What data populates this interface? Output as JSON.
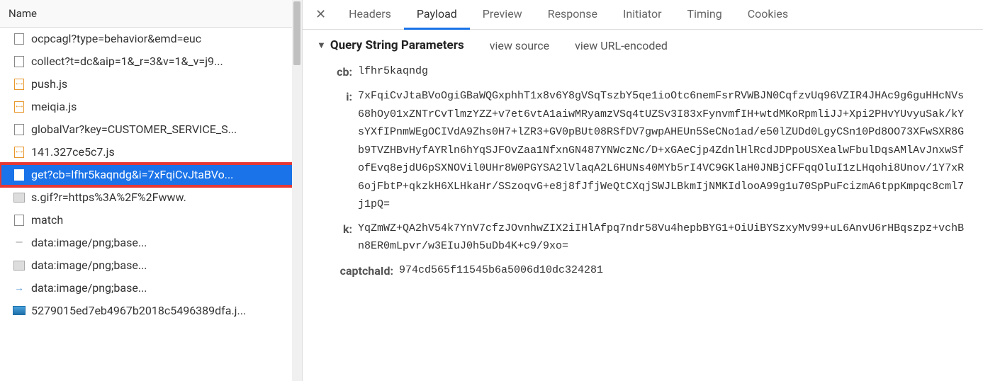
{
  "left_panel": {
    "header": "Name",
    "requests": [
      {
        "icon": "doc",
        "label": "ocpcagl?type=behavior&emd=euc"
      },
      {
        "icon": "doc",
        "label": "collect?t=dc&aip=1&_r=3&v=1&_v=j9..."
      },
      {
        "icon": "js",
        "label": "push.js"
      },
      {
        "icon": "js",
        "label": "meiqia.js"
      },
      {
        "icon": "doc",
        "label": "globalVar?key=CUSTOMER_SERVICE_S..."
      },
      {
        "icon": "js",
        "label": "141.327ce5c7.js"
      },
      {
        "icon": "fetch",
        "label": "get?cb=lfhr5kaqndg&i=7xFqiCvJtaBVo...",
        "selected": true,
        "highlighted": true
      },
      {
        "icon": "img",
        "label": "s.gif?r=https%3A%2F%2Fwww."
      },
      {
        "icon": "doc",
        "label": "match"
      },
      {
        "icon": "dash",
        "label": "data:image/png;base..."
      },
      {
        "icon": "img",
        "label": "data:image/png;base..."
      },
      {
        "icon": "arrow",
        "label": "data:image/png;base..."
      },
      {
        "icon": "pic",
        "label": "5279015ed7eb4967b2018c5496389dfa.j..."
      }
    ]
  },
  "right_panel": {
    "tabs": [
      "Headers",
      "Payload",
      "Preview",
      "Response",
      "Initiator",
      "Timing",
      "Cookies"
    ],
    "active_tab": "Payload",
    "section_title": "Query String Parameters",
    "view_source_label": "view source",
    "view_url_encoded_label": "view URL-encoded",
    "params": {
      "cb": "lfhr5kaqndg",
      "i": "7xFqiCvJtaBVoOgiGBaWQGxphhT1x8v6Y8gVSqTszbY5qe1ioOtc6nemFsrRVWBJN0CqfzvUq96VZIR4JHAc9g6guHHcNVs68hOy01xZNTrCvTlmzYZZ+v7et6vtA1aiwMRyamzVSq4tUZSv3I83xFynvmfIH+wtdMKoRpmliJJ+Xpi2PHvYUvyuSak/kYsYXfIPnmWEgOCIVdA9Zhs0H7+lZR3+GV0pBUt08RSfDV7gwpAHEUn5SeCNo1ad/e50lZUDd0LgyCSn10Pd8OO73XFwSXR8Gb9TVZHBvHyfAYRln6hYqSJFOvZaa1NfxnGN487YNWczNc/D+xGAeCjp4ZdnlHlRcdJDPpoUSXealwFbulDqsAMlAvJnxwSfofEvq8ejdU6pSXNOVil0UHr8W0PGYSA2lVlaqA2L6HUNs40MYb5rI4VC9GKlaH0JNBjCFFqqOluI1zLHqohi8Unov/1Y7xR6ojFbtP+qkzkH6XLHkaHr/SSzoqvG+e8j8fJfjWeQtCXqjSWJLBkmIjNMKIdlooA99g1u70SpPuFcizmA6tppKmpqc8cml7j1pQ=",
      "k": "YqZmWZ+QA2hV54k7YnV7cfzJOvnhwZIX2iIHlAfpq7ndr58Vu4hepbBYG1+OiUiBYSzxyMv99+uL6AnvU6rHBqszpz+vchBn8ER0mLpvr/w3EIuJ0h5uDb4K+c9/9xo=",
      "captchaId": "974cd565f11545b6a5006d10dc324281"
    }
  }
}
